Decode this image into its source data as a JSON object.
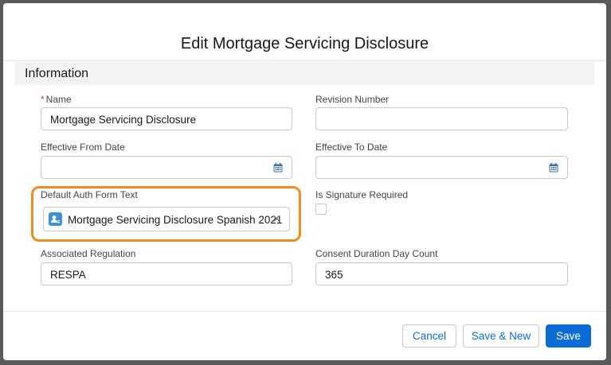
{
  "modal": {
    "title": "Edit Mortgage Servicing Disclosure",
    "section_title": "Information"
  },
  "fields": {
    "name": {
      "label": "Name",
      "required_marker": "*",
      "value": "Mortgage Servicing Disclosure"
    },
    "revision_number": {
      "label": "Revision Number",
      "value": ""
    },
    "effective_from_date": {
      "label": "Effective From Date",
      "value": ""
    },
    "effective_to_date": {
      "label": "Effective To Date",
      "value": ""
    },
    "default_auth_form_text": {
      "label": "Default Auth Form Text",
      "selected": "Mortgage Servicing Disclosure Spanish 2021",
      "clear_glyph": "✕"
    },
    "is_signature_required": {
      "label": "Is Signature Required",
      "checked": false
    },
    "associated_regulation": {
      "label": "Associated Regulation",
      "value": "RESPA"
    },
    "consent_duration_day_count": {
      "label": "Consent Duration Day Count",
      "value": "365"
    }
  },
  "buttons": {
    "cancel": "Cancel",
    "save_and_new": "Save & New",
    "save": "Save"
  },
  "colors": {
    "highlight": "#f28c1c",
    "brand": "#0b6cd6",
    "required": "#c23934",
    "record_icon": "#3a93d6"
  },
  "icons": {
    "calendar": "calendar-icon",
    "record": "record-icon",
    "clear": "close-icon"
  }
}
